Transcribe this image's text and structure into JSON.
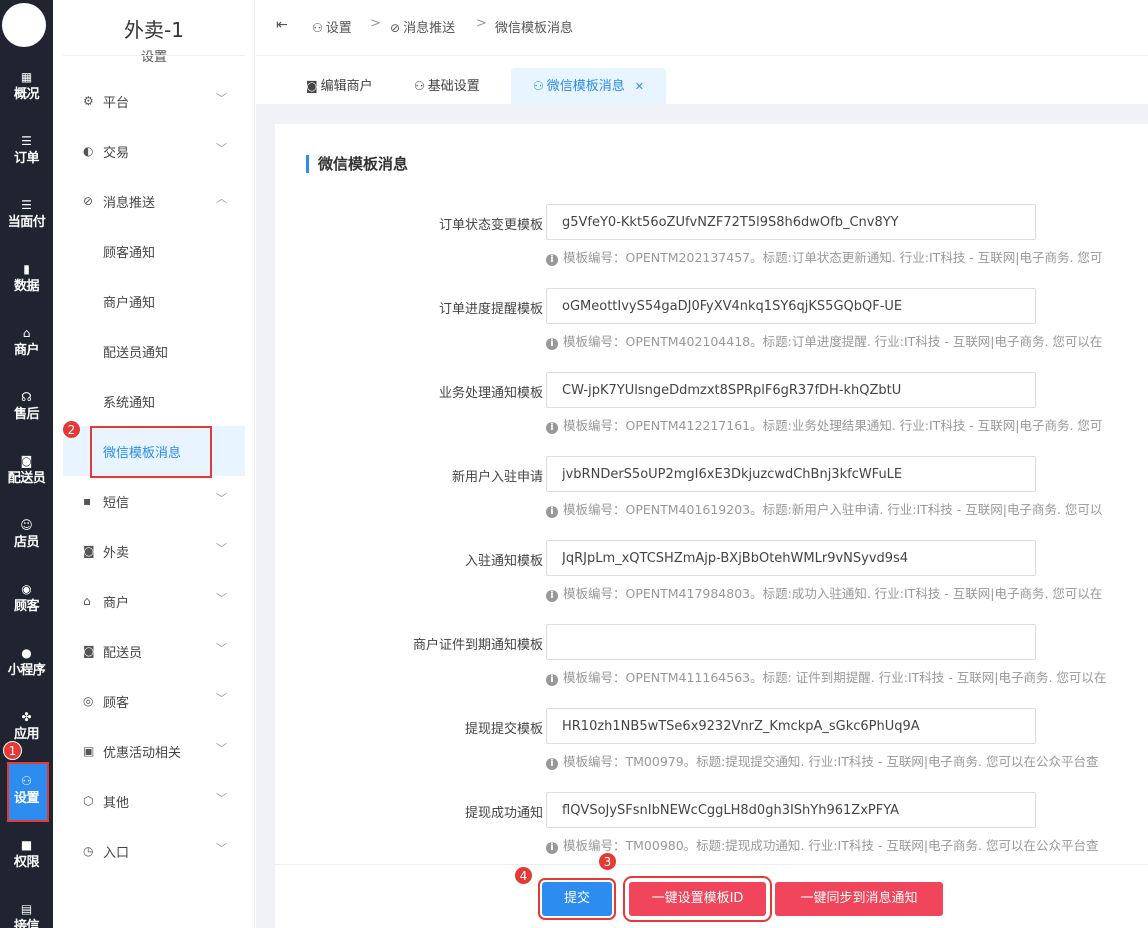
{
  "rail": {
    "items": [
      {
        "label": "概况",
        "icon": "dashboard-icon"
      },
      {
        "label": "订单",
        "icon": "list-icon"
      },
      {
        "label": "当面付",
        "icon": "list-icon"
      },
      {
        "label": "数据",
        "icon": "bar-chart-icon"
      },
      {
        "label": "商户",
        "icon": "store-icon"
      },
      {
        "label": "售后",
        "icon": "headset-icon"
      },
      {
        "label": "配送员",
        "icon": "scooter-icon"
      },
      {
        "label": "店员",
        "icon": "users-icon"
      },
      {
        "label": "顾客",
        "icon": "user-circle-icon"
      },
      {
        "label": "小程序",
        "icon": "wechat-icon"
      },
      {
        "label": "应用",
        "icon": "apps-icon"
      },
      {
        "label": "设置",
        "icon": "user-settings-icon"
      },
      {
        "label": "权限",
        "icon": "lock-icon"
      },
      {
        "label": "接信",
        "icon": "doc-chart-icon"
      }
    ],
    "badge": "1"
  },
  "sidebar": {
    "title": "外卖-1",
    "subtitle": "设置",
    "menus": [
      {
        "label": "平台",
        "icon": "gear-icon"
      },
      {
        "label": "交易",
        "icon": "trade-icon"
      },
      {
        "label": "消息推送",
        "icon": "push-icon"
      }
    ],
    "submenus": [
      "顾客通知",
      "商户通知",
      "配送员通知",
      "系统通知",
      "微信模板消息"
    ],
    "menus2": [
      {
        "label": "短信",
        "icon": "sms-icon"
      },
      {
        "label": "外卖",
        "icon": "scooter-icon"
      },
      {
        "label": "商户",
        "icon": "store-icon"
      },
      {
        "label": "配送员",
        "icon": "rider-icon"
      },
      {
        "label": "顾客",
        "icon": "user-circle-icon"
      },
      {
        "label": "优惠活动相关",
        "icon": "gift-icon"
      },
      {
        "label": "其他",
        "icon": "hexagon-icon"
      },
      {
        "label": "入口",
        "icon": "compass-icon"
      }
    ],
    "badge": "2"
  },
  "breadcrumb": {
    "items": [
      "设置",
      "消息推送",
      "微信模板消息"
    ],
    "separator": ">"
  },
  "tabs": [
    "编辑商户",
    "基础设置",
    "微信模板消息"
  ],
  "section_title": "微信模板消息",
  "fields": [
    {
      "label": "订单状态变更模板",
      "value": "g5VfeY0-Kkt56oZUfvNZF72T5l9S8h6dwOfb_Cnv8YY",
      "hint": "模板编号：OPENTM202137457。标题:订单状态更新通知. 行业:IT科技 - 互联网|电子商务. 您可"
    },
    {
      "label": "订单进度提醒模板",
      "value": "oGMeottIvyS54gaDJ0FyXV4nkq1SY6qjKS5GQbQF-UE",
      "hint": "模板编号：OPENTM402104418。标题:订单进度提醒. 行业:IT科技 - 互联网|电子商务. 您可以在"
    },
    {
      "label": "业务处理通知模板",
      "value": "CW-jpK7YUlsngeDdmzxt8SPRplF6gR37fDH-khQZbtU",
      "hint": "模板编号：OPENTM412217161。标题:业务处理结果通知. 行业:IT科技 - 互联网|电子商务. 您可"
    },
    {
      "label": "新用户入驻申请",
      "value": "jvbRNDerS5oUP2mgI6xE3DkjuzcwdChBnj3kfcWFuLE",
      "hint": "模板编号：OPENTM401619203。标题:新用户入驻申请. 行业:IT科技 - 互联网|电子商务. 您可以"
    },
    {
      "label": "入驻通知模板",
      "value": "JqRJpLm_xQTCSHZmAjp-BXjBbOtehWMLr9vNSyvd9s4",
      "hint": "模板编号：OPENTM417984803。标题:成功入驻通知. 行业:IT科技 - 互联网|电子商务. 您可以在"
    },
    {
      "label": "商户证件到期通知模板",
      "value": "",
      "hint": "模板编号：OPENTM411164563。标题: 证件到期提醒. 行业:IT科技 - 互联网|电子商务. 您可以在"
    },
    {
      "label": "提现提交模板",
      "value": "HR10zh1NB5wTSe6x9232VnrZ_KmckpA_sGkc6PhUq9A",
      "hint": "模板编号：TM00979。标题:提现提交通知. 行业:IT科技 - 互联网|电子商务. 您可以在公众平台查"
    },
    {
      "label": "提现成功通知",
      "value": "flQVSoJySFsnIbNEWcCggLH8d0gh3IShYh961ZxPFYA",
      "hint": "模板编号：TM00980。标题:提现成功通知. 行业:IT科技 - 互联网|电子商务. 您可以在公众平台查"
    }
  ],
  "buttons": {
    "submit": "提交",
    "set_template": "一键设置模板ID",
    "sync": "一键同步到消息通知"
  },
  "badges": {
    "b3": "3",
    "b4": "4"
  },
  "colors": {
    "primary": "#2d8cf0",
    "danger": "#f0455a",
    "highlight": "#e53935",
    "rail_bg": "#1f2430"
  }
}
